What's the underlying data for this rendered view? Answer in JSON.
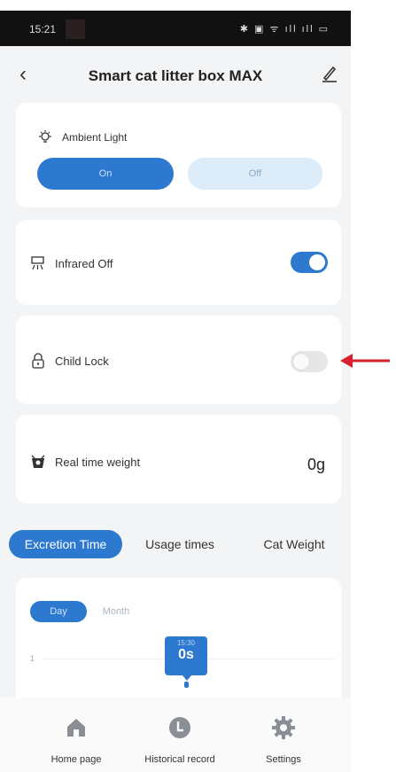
{
  "status_bar": {
    "time": "15:21",
    "icons_text": "✱ ▣ ᯤ ıll ıll ▭"
  },
  "header": {
    "title": "Smart cat litter box MAX"
  },
  "ambient_light": {
    "label": "Ambient Light",
    "on_label": "On",
    "off_label": "Off",
    "selected": "On"
  },
  "infrared": {
    "label": "Infrared Off",
    "enabled": true
  },
  "child_lock": {
    "label": "Child Lock",
    "enabled": false
  },
  "weight": {
    "label": "Real time weight",
    "value": "0g"
  },
  "tabs": [
    {
      "label": "Excretion Time",
      "active": true
    },
    {
      "label": "Usage times",
      "active": false
    },
    {
      "label": "Cat Weight",
      "active": false
    }
  ],
  "chart": {
    "segments": [
      {
        "label": "Day",
        "active": true
      },
      {
        "label": "Month",
        "active": false
      }
    ],
    "y_tick": "1",
    "tooltip_time": "15:30",
    "tooltip_value": "0s"
  },
  "bottom_nav": [
    {
      "label": "Home page",
      "icon": "home-icon"
    },
    {
      "label": "Historical record",
      "icon": "history-icon"
    },
    {
      "label": "Settings",
      "icon": "gear-icon"
    }
  ],
  "colors": {
    "accent": "#2c79cf",
    "accent_light": "#ddecf9",
    "annotation_arrow": "#d8202a"
  }
}
